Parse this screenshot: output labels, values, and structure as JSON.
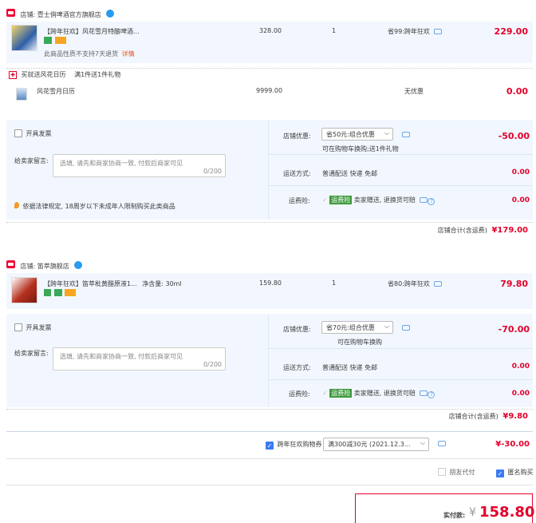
{
  "shop1": {
    "name": "店铺: 壹士俏啤酒官方旗舰店",
    "item": {
      "title": "【跨年狂欢】风花雪月特酿啤酒...",
      "price": "328.00",
      "qty": "1",
      "discount": "省99:跨年狂欢",
      "total": "229.00",
      "notice": "此商品性质不支持7天退货",
      "notice_link": "详情"
    },
    "gift_banner": "买就送风花日历",
    "gift_rule": "满1件送1件礼物",
    "gift": {
      "title": "风花雪月日历",
      "price": "9999.00",
      "discount": "无优惠",
      "total": "0.00"
    },
    "invoice_label": "开具发票",
    "message_label": "给卖家留言:",
    "message_placeholder": "选填, 请先和商家协商一致, 付款后商家可见",
    "message_count": "0/200",
    "coupon_label": "店铺优惠:",
    "coupon_select": "省50元:组合优惠",
    "coupon_value": "-50.00",
    "coupon_note": "可在购物车换购;送1件礼物",
    "shipping_label": "运送方式:",
    "shipping_value": "普通配送 快递 免邮",
    "shipping_fee": "0.00",
    "insurance_label": "运费险:",
    "insurance_badge": "运费险",
    "insurance_text": "卖家赠送, 退换货可赔",
    "insurance_fee": "0.00",
    "law_notice": "依据法律规定, 18周岁以下未成年人限制购买此类商品",
    "subtotal_label": "店铺合计(含运费)",
    "subtotal_value": "¥179.00"
  },
  "shop2": {
    "name": "店铺: 笛萃旗舰店",
    "item": {
      "title": "【跨年狂欢】笛萃枇黄醋原液1...",
      "spec": "净含量: 30ml",
      "price": "159.80",
      "qty": "1",
      "discount": "省80:跨年狂欢",
      "total": "79.80"
    },
    "invoice_label": "开具发票",
    "message_label": "给卖家留言:",
    "message_placeholder": "选填, 请先和商家协商一致, 付款后商家可见",
    "message_count": "0/200",
    "coupon_label": "店铺优惠:",
    "coupon_select": "省70元:组合优惠",
    "coupon_value": "-70.00",
    "coupon_note": "可在购物车换购",
    "shipping_label": "运送方式:",
    "shipping_value": "普通配送 快递 免邮",
    "shipping_fee": "0.00",
    "insurance_label": "运费险:",
    "insurance_badge": "运费险",
    "insurance_text": "卖家赠送, 退换货可赔",
    "insurance_fee": "0.00",
    "subtotal_label": "店铺合计(含运费)",
    "subtotal_value": "¥9.80"
  },
  "platform": {
    "coupon_label": "跨年狂欢购物券",
    "coupon_select": "满300减30元 (2021.12.3...",
    "coupon_value": "¥-30.00"
  },
  "options": {
    "friend_pay": "朋友代付",
    "anonymous": "匿名购买"
  },
  "payment": {
    "label": "实付款:",
    "currency": "¥",
    "amount": "158.80"
  },
  "colors": {
    "accent_red": "#e4002b",
    "panel_blue": "#f2f7ff",
    "link_blue": "#3a7af5"
  }
}
